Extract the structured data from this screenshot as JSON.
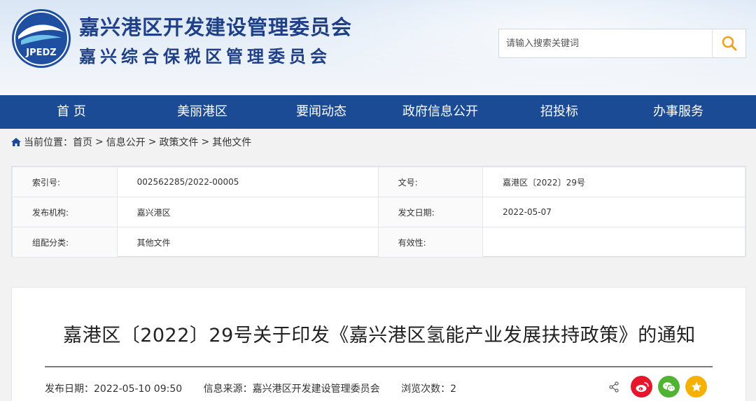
{
  "header": {
    "title_cn": "嘉兴港区开发建设管理委员会",
    "subtitle_cn": "嘉兴综合保税区管理委员会",
    "logo_text": "JPEDZ"
  },
  "search": {
    "placeholder": "请输入搜索关键词",
    "icon": "search-icon"
  },
  "nav": {
    "items": [
      "首 页",
      "美丽港区",
      "要闻动态",
      "政府信息公开",
      "招投标",
      "办事服务"
    ]
  },
  "breadcrumb": {
    "label": "当前位置：",
    "items": [
      "首页",
      "信息公开",
      "政策文件",
      "其他文件"
    ],
    "separators": [
      ">",
      ">",
      ">"
    ]
  },
  "info": {
    "rows": [
      {
        "k1": "索引号:",
        "v1": "002562285/2022-00005",
        "k2": "文号:",
        "v2": "嘉港区〔2022〕29号"
      },
      {
        "k1": "发布机构:",
        "v1": "嘉兴港区",
        "k2": "发文日期:",
        "v2": "2022-05-07"
      },
      {
        "k1": "组配分类:",
        "v1": "其他文件",
        "k2": "有效性:",
        "v2": ""
      }
    ]
  },
  "article": {
    "title": "嘉港区〔2022〕29号关于印发《嘉兴港区氢能产业发展扶持政策》的通知",
    "publish_date": "发布日期：2022-05-10 09:50",
    "source": "信息来源：嘉兴港区开发建设管理委员会",
    "views": "浏览次数：2"
  },
  "colors": {
    "nav_bg": "#1c4b95",
    "title_blue": "#1f3f87",
    "weibo": "#e6162d",
    "wechat": "#51b332",
    "favorite": "#f5b000"
  }
}
